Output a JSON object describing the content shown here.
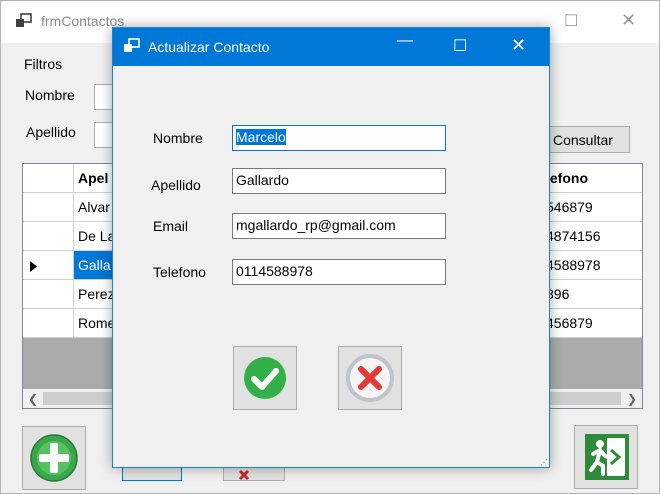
{
  "bg": {
    "title": "frmContactos",
    "filters_label": "Filtros",
    "nombre_label": "Nombre",
    "apellido_label": "Apellido",
    "consultar_button": "Consultar",
    "grid": {
      "headers": [
        "Apel",
        "lefono"
      ],
      "rows": [
        {
          "apellido": "Alvar",
          "telefono": "546879",
          "selected": false
        },
        {
          "apellido": "De La",
          "telefono": "4874156",
          "selected": false
        },
        {
          "apellido": "Galla",
          "telefono": "4588978",
          "selected": true
        },
        {
          "apellido": "Perez",
          "telefono": "896",
          "selected": false
        },
        {
          "apellido": "Rome",
          "telefono": "456879",
          "selected": false
        }
      ]
    }
  },
  "dialog": {
    "title": "Actualizar Contacto",
    "fields": {
      "nombre": {
        "label": "Nombre",
        "value": "Marcelo"
      },
      "apellido": {
        "label": "Apellido",
        "value": "Gallardo"
      },
      "email": {
        "label": "Email",
        "value": "mgallardo_rp@gmail.com"
      },
      "telefono": {
        "label": "Telefono",
        "value": "0114588978"
      }
    }
  },
  "icons": {
    "app": "window-icon",
    "ok": "check-circle-icon",
    "cancel": "x-circle-icon",
    "add": "plus-circle-icon",
    "exit": "exit-running-man-icon"
  },
  "colors": {
    "accent": "#0078d7",
    "ok_green": "#34b04a",
    "cancel_red": "#e53935",
    "exit_green": "#2e8b3a"
  }
}
